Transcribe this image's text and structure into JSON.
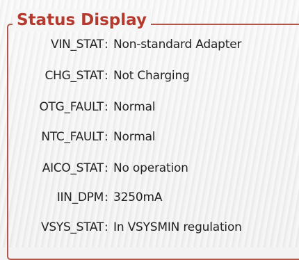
{
  "group": {
    "title": "Status Display"
  },
  "separator": ":",
  "rows": [
    {
      "label": "VIN_STAT",
      "value": "Non-standard Adapter"
    },
    {
      "label": "CHG_STAT",
      "value": "Not Charging"
    },
    {
      "label": "OTG_FAULT",
      "value": "Normal"
    },
    {
      "label": "NTC_FAULT",
      "value": "Normal"
    },
    {
      "label": "AICO_STAT",
      "value": "No operation"
    },
    {
      "label": "IIN_DPM",
      "value": "3250mA"
    },
    {
      "label": "VSYS_STAT",
      "value": "In VSYSMIN regulation"
    }
  ]
}
